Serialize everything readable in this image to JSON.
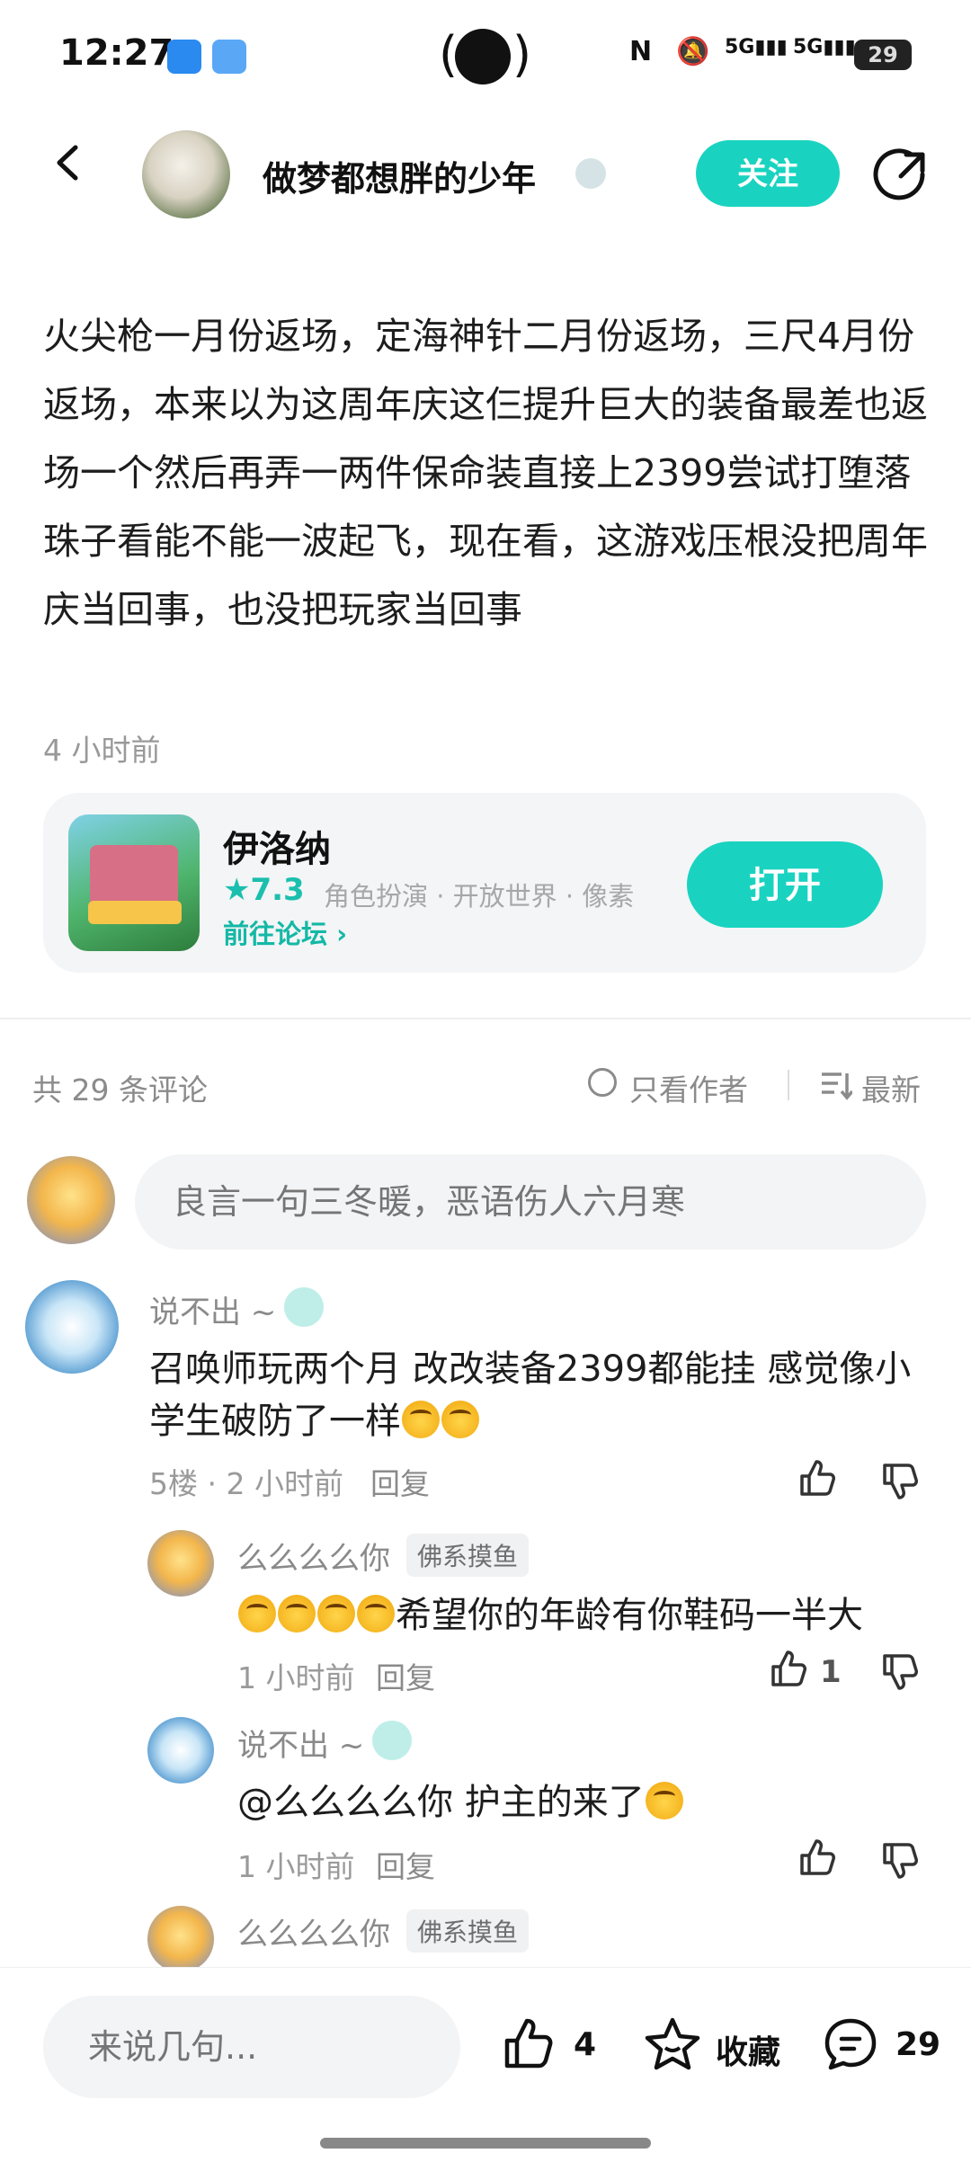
{
  "status_bar": {
    "time": "12:27",
    "battery": "29"
  },
  "header": {
    "username": "做梦都想胖的少年",
    "follow_label": "关注"
  },
  "post": {
    "text": "火尖枪一月份返场，定海神针二月份返场，三尺4月份返场，本来以为这周年庆这仨提升巨大的装备最差也返场一个然后再弄一两件保命装直接上2399尝试打堕落珠子看能不能一波起飞，现在看，这游戏压根没把周年庆当回事，也没把玩家当回事",
    "time": "4 小时前"
  },
  "game_card": {
    "name": "伊洛纳",
    "rating": "★7.3",
    "tags": "角色扮演 · 开放世界 · 像素",
    "forum_link": "前往论坛 ›",
    "open_label": "打开"
  },
  "comments_header": {
    "count": "共 29 条评论",
    "only_author": "只看作者",
    "sort": "最新"
  },
  "comment_input": {
    "placeholder": "良言一句三冬暖，恶语伤人六月寒"
  },
  "comments": [
    {
      "name": "说不出 ~",
      "text": "召唤师玩两个月 改改装备2399都能挂 感觉像小学生破防了一样",
      "meta": "5楼 · 2 小时前",
      "reply": "回复"
    },
    {
      "name": "么么么么你",
      "tag": "佛系摸鱼",
      "text": "希望你的年龄有你鞋码一半大",
      "meta": "1 小时前",
      "reply": "回复",
      "likes": "1"
    },
    {
      "name": "说不出 ~",
      "text": "@么么么么你  护主的来了",
      "meta": "1 小时前",
      "reply": "回复"
    },
    {
      "name": "么么么么你",
      "tag": "佛系摸鱼"
    }
  ],
  "bottom_bar": {
    "input_placeholder": "来说几句...",
    "like_count": "4",
    "favorite_label": "收藏",
    "comment_count": "29"
  },
  "colors": {
    "accent": "#19d3c0",
    "muted": "#8b8b8b"
  },
  "icons": [
    "back-arrow-icon",
    "share-icon",
    "thumb-up-icon",
    "thumb-down-icon",
    "star-icon",
    "chat-icon",
    "sort-icon"
  ]
}
